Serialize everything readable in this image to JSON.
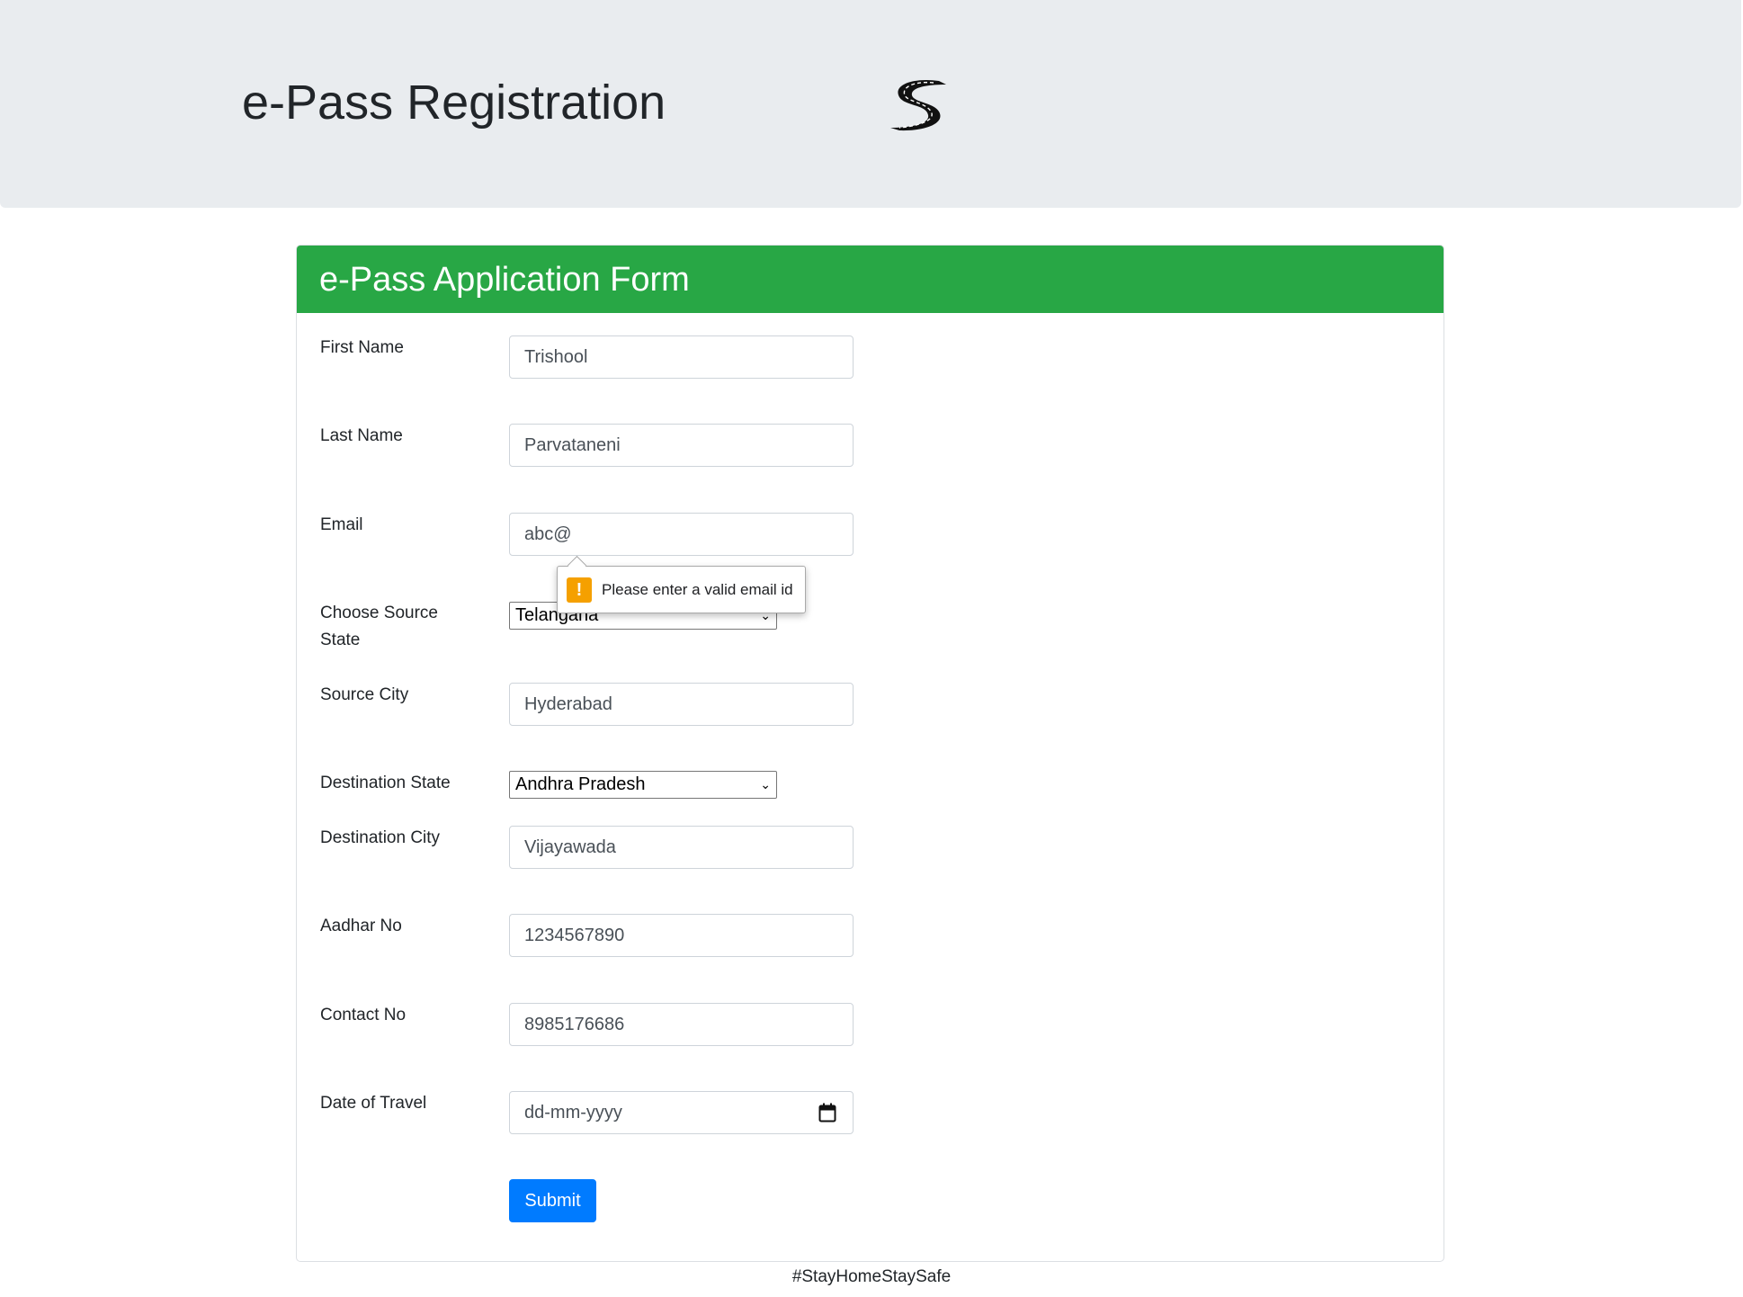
{
  "header": {
    "title": "e-Pass Registration",
    "logo_icon": "winding-road-s-logo"
  },
  "form": {
    "title": "e-Pass Application Form",
    "fields": {
      "first_name": {
        "label": "First Name",
        "value": "Trishool"
      },
      "last_name": {
        "label": "Last Name",
        "value": "Parvataneni"
      },
      "email": {
        "label": "Email",
        "value": "abc@"
      },
      "source_state": {
        "label": "Choose Source State",
        "value": "Telangana"
      },
      "source_city": {
        "label": "Source City",
        "value": "Hyderabad"
      },
      "destination_state": {
        "label": "Destination State",
        "value": "Andhra Pradesh"
      },
      "destination_city": {
        "label": "Destination City",
        "value": "Vijayawada"
      },
      "aadhar": {
        "label": "Aadhar No",
        "value": "1234567890"
      },
      "contact": {
        "label": "Contact No",
        "value": "8985176686"
      },
      "travel_date": {
        "label": "Date of Travel",
        "placeholder": "dd-mm-yyyy"
      }
    },
    "validation_message": "Please enter a valid email id",
    "submit_label": "Submit"
  },
  "footer": {
    "tagline": "#StayHomeStaySafe"
  },
  "colors": {
    "header_bg": "#e9ecef",
    "card_header": "#28a745",
    "submit": "#007bff",
    "warning": "#f5a000"
  }
}
